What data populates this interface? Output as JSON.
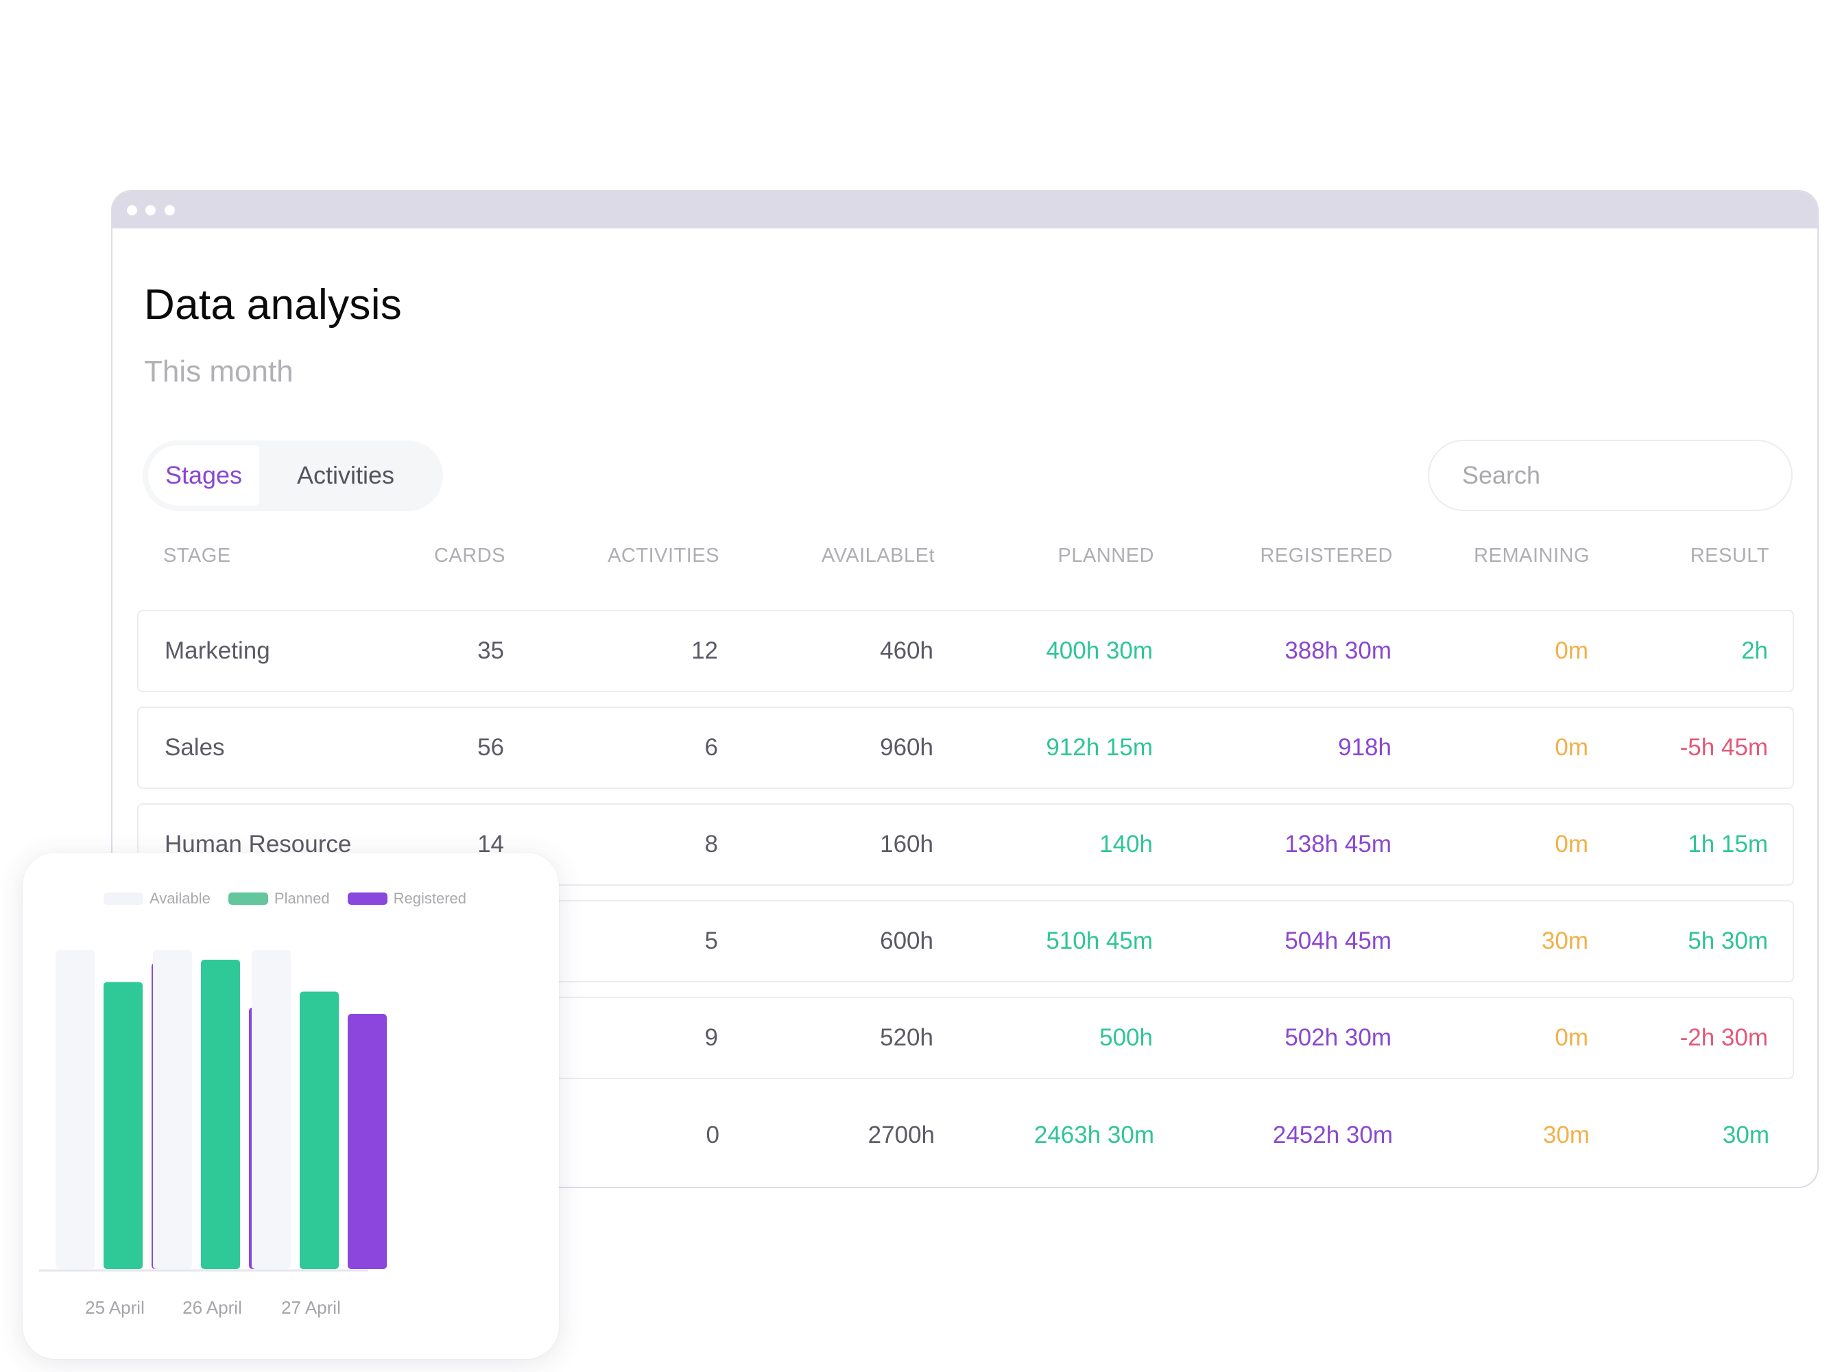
{
  "window": {
    "title_dots": 3
  },
  "header": {
    "title": "Data analysis",
    "subtitle": "This month"
  },
  "tabs": [
    {
      "label": "Stages",
      "active": true
    },
    {
      "label": "Activities",
      "active": false
    }
  ],
  "search": {
    "placeholder": "Search",
    "value": ""
  },
  "table": {
    "columns": [
      "STAGE",
      "CARDS",
      "ACTIVITIES",
      "AVAILABLEt",
      "PLANNED",
      "REGISTERED",
      "REMAINING",
      "RESULT"
    ],
    "rows": [
      {
        "stage": "Marketing",
        "cards": "35",
        "activities": "12",
        "available": "460h",
        "planned": "400h 30m",
        "registered": "388h 30m",
        "remaining": "0m",
        "result": "2h",
        "result_status": "positive"
      },
      {
        "stage": "Sales",
        "cards": "56",
        "activities": "6",
        "available": "960h",
        "planned": "912h 15m",
        "registered": "918h",
        "remaining": "0m",
        "result": "-5h 45m",
        "result_status": "negative"
      },
      {
        "stage": "Human Resource",
        "cards": "14",
        "activities": "8",
        "available": "160h",
        "planned": "140h",
        "registered": "138h 45m",
        "remaining": "0m",
        "result": "1h 15m",
        "result_status": "positive"
      },
      {
        "stage": "",
        "cards": "",
        "activities": "5",
        "available": "600h",
        "planned": "510h 45m",
        "registered": "504h 45m",
        "remaining": "30m",
        "result": "5h 30m",
        "result_status": "positive"
      },
      {
        "stage": "",
        "cards": "",
        "activities": "9",
        "available": "520h",
        "planned": "500h",
        "registered": "502h 30m",
        "remaining": "0m",
        "result": "-2h 30m",
        "result_status": "negative"
      }
    ],
    "total": {
      "stage": "",
      "cards": "",
      "activities": "0",
      "available": "2700h",
      "planned": "2463h 30m",
      "registered": "2452h 30m",
      "remaining": "30m",
      "result": "30m",
      "result_status": "positive"
    }
  },
  "colors": {
    "accent": "#8a47d1",
    "planned": "#2fc596",
    "registered": "#8a47d1",
    "available": "#f5f6fa",
    "remaining": "#f2b04a",
    "negative": "#e4587a",
    "legend_planned": "#63c69c"
  },
  "chart_data": {
    "type": "bar",
    "title": "",
    "xlabel": "",
    "ylabel": "",
    "categories": [
      "25 April",
      "26 April",
      "27 April"
    ],
    "series": [
      {
        "name": "Available",
        "values": [
          100,
          100,
          100
        ]
      },
      {
        "name": "Planned",
        "values": [
          90,
          97,
          87
        ]
      },
      {
        "name": "Registered",
        "values": [
          96,
          82,
          80
        ]
      }
    ],
    "ylim": [
      0,
      100
    ],
    "grid": false,
    "legend": "top-center",
    "value_unit": "relative (% of available)"
  }
}
